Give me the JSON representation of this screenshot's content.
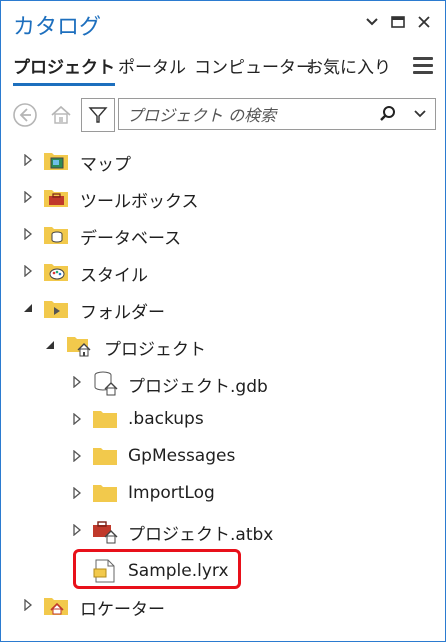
{
  "window": {
    "title": "カタログ"
  },
  "tabs": [
    {
      "label": "プロジェクト",
      "active": true
    },
    {
      "label": "ポータル",
      "active": false
    },
    {
      "label": "コンピューター",
      "active": false
    },
    {
      "label": "お気に入り",
      "active": false
    }
  ],
  "search": {
    "placeholder": "プロジェクト の検索"
  },
  "tree": {
    "maps": "マップ",
    "toolboxes": "ツールボックス",
    "databases": "データベース",
    "styles": "スタイル",
    "folders": "フォルダー",
    "project_folder": "プロジェクト",
    "gdb": "プロジェクト.gdb",
    "backups": ".backups",
    "gpmessages": "GpMessages",
    "importlog": "ImportLog",
    "atbx": "プロジェクト.atbx",
    "lyrx": "Sample.lyrx",
    "locators": "ロケーター"
  },
  "colors": {
    "accent": "#1d6fbe",
    "folder": "#f2c94c",
    "highlight": "#e8101a"
  }
}
